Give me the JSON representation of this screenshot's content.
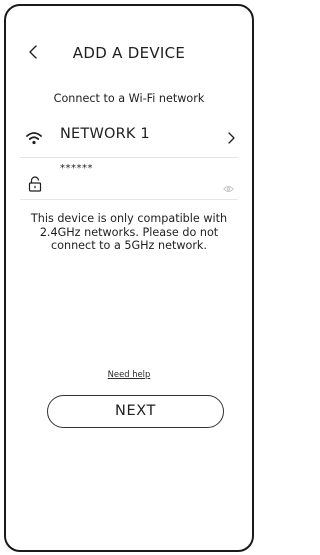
{
  "header": {
    "title": "ADD A DEVICE",
    "back_icon": "chevron-left-icon"
  },
  "subtitle": "Connect to a Wi-Fi network",
  "network": {
    "icon": "wifi-icon",
    "name": "NETWORK 1",
    "chevron_icon": "chevron-right-icon"
  },
  "password": {
    "icon": "lock-icon",
    "value": "******",
    "visibility_icon": "eye-icon"
  },
  "notice": "This device is only compatible with 2.4GHz networks. Please do not connect to a 5GHz network.",
  "help_link": "Need help",
  "next_button": "NEXT"
}
